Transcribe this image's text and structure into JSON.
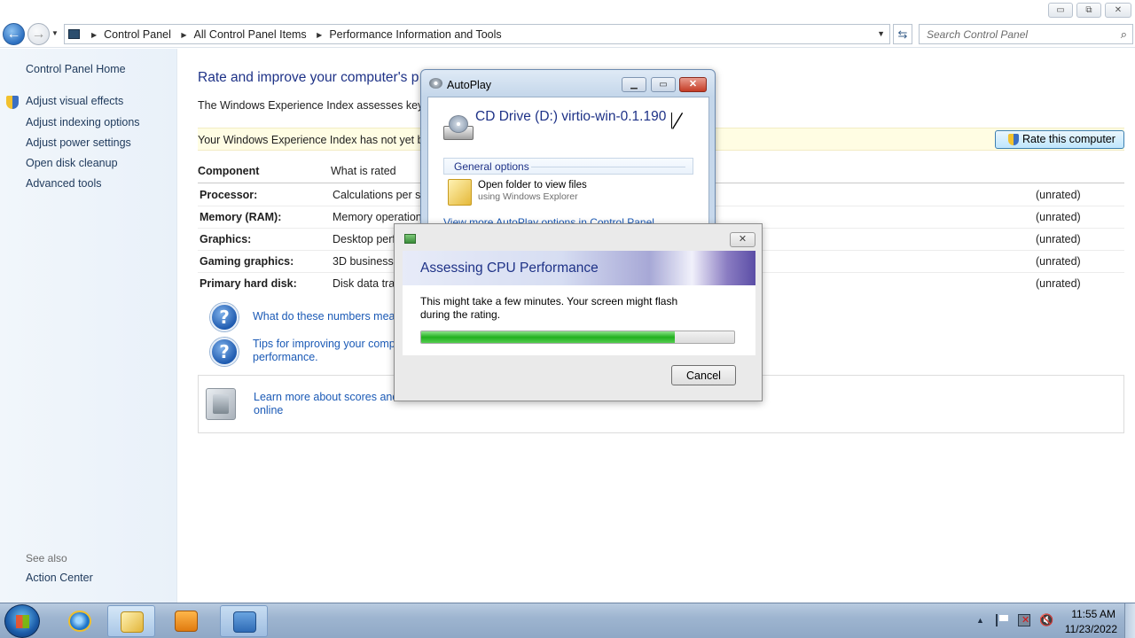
{
  "window": {
    "minimize_label": "▭",
    "maximize_label": "⧉",
    "close_label": "✕"
  },
  "navbar": {
    "back_icon": "←",
    "forward_icon": "→",
    "breadcrumbs": [
      "Control Panel",
      "All Control Panel Items",
      "Performance Information and Tools"
    ],
    "search_placeholder": "Search Control Panel"
  },
  "sidebar": {
    "home": "Control Panel Home",
    "items": [
      {
        "label": "Adjust visual effects",
        "icon": "shield-icon"
      },
      {
        "label": "Adjust indexing options"
      },
      {
        "label": "Adjust power settings"
      },
      {
        "label": "Open disk cleanup"
      },
      {
        "label": "Advanced tools"
      }
    ],
    "see_also": "See also",
    "action_center": "Action Center"
  },
  "main": {
    "heading": "Rate and improve your computer's p",
    "intro": "The Windows Experience Index assesses key syst",
    "banner": "Your Windows Experience Index has not yet bee",
    "rate_button": "Rate this computer",
    "table": {
      "headers": [
        "Component",
        "What is rated"
      ],
      "rows": [
        {
          "component": "Processor:",
          "what": "Calculations per se",
          "score": "(unrated)"
        },
        {
          "component": "Memory (RAM):",
          "what": "Memory operation",
          "score": "(unrated)"
        },
        {
          "component": "Graphics:",
          "what": "Desktop perfo",
          "score": "(unrated)"
        },
        {
          "component": "Gaming graphics:",
          "what": "3D business a",
          "score": "(unrated)"
        },
        {
          "component": "Primary hard disk:",
          "what": "Disk data tran",
          "score": "(unrated)"
        }
      ]
    },
    "help_links": [
      {
        "line1": "What do these numbers mean",
        "line2": ""
      },
      {
        "line1": "Tips for improving your comp",
        "line2": "performance."
      }
    ],
    "learn_more": {
      "line1": "Learn more about scores and s",
      "line2": "online"
    }
  },
  "autoplay": {
    "title": "AutoPlay",
    "drive_title": "CD Drive (D:) virtio-win-0.1.190",
    "section": "General options",
    "option_title": "Open folder to view files",
    "option_sub": "using Windows Explorer",
    "more_link": "View more AutoPlay options in Control Panel"
  },
  "assess": {
    "title": "Assessing CPU Performance",
    "message": "This might take a few minutes. Your screen might flash during the rating.",
    "progress": 0.81,
    "cancel": "Cancel"
  },
  "taskbar": {
    "time": "11:55 AM",
    "date": "11/23/2022",
    "tray_arrow": "▲",
    "volume_icon": "🔇"
  }
}
